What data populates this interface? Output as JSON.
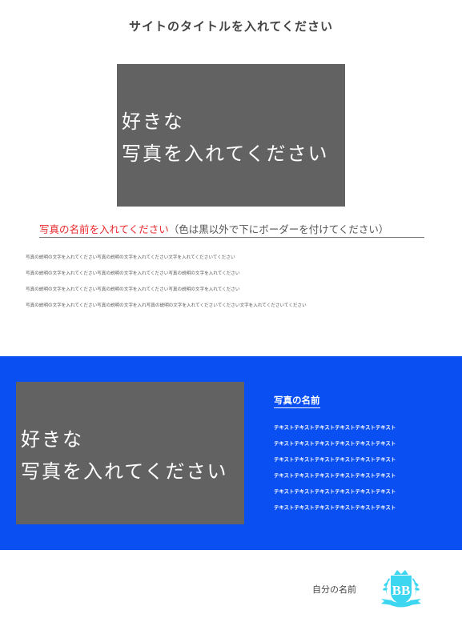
{
  "header": {
    "site_title": "サイトのタイトルを入れてください"
  },
  "hero": {
    "photo_line1": "好きな",
    "photo_line2": "写真を入れてください",
    "caption_name": "写真の名前を入れてください",
    "caption_note": "（色は黒以外で下にボーダーを付けてください）",
    "description_lines": [
      "写真の説明の文字を入れてください写真の説明の文字を入れてください文字を入れてくださいてください",
      "写真の説明の文字を入れてください写真の説明の文字を入れてください写真の説明の文字を入れてください",
      "写真の説明の文字を入れてください写真の説明の文字を入れてください写真の説明の文字を入れてください",
      "写真の説明の文字を入れてください写真の説明の文字を入れ写真の説明の文字を入れてくださいてください文字を入れてくださいてください"
    ]
  },
  "feature": {
    "photo_line1": "好きな",
    "photo_line2": "写真を入れてください",
    "title": "写真の名前",
    "lines": [
      "テキストテキストテキストテキストテキストテキスト",
      "テキストテキストテキストテキストテキストテキスト",
      "テキストテキストテキストテキストテキストテキスト",
      "テキストテキストテキストテキストテキストテキスト",
      "テキストテキストテキストテキストテキストテキスト",
      "テキストテキストテキストテキストテキストテキスト"
    ]
  },
  "footer": {
    "name": "自分の名前",
    "logo_icon": "bb-monogram-crest-icon",
    "logo_text": "BB"
  },
  "colors": {
    "band": "#0a4ff2",
    "photo_placeholder": "#626262",
    "caption_accent": "#e8282b",
    "logo": "#3dd6f0"
  }
}
